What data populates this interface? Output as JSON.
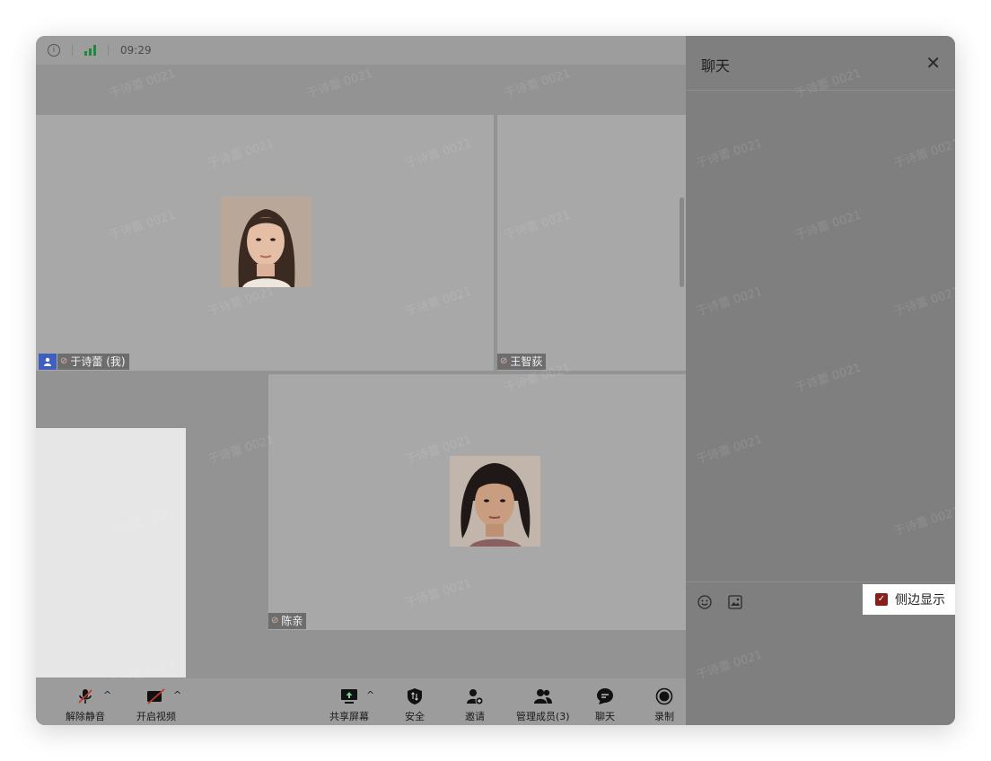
{
  "status": {
    "time": "09:29"
  },
  "participants": [
    {
      "name": "于诗蕾 (我)",
      "is_me": true
    },
    {
      "name": "王智荻"
    },
    {
      "name": "陈亲"
    }
  ],
  "chat": {
    "title": "聊天",
    "side_display_label": "侧边显示",
    "side_display_checked": true
  },
  "toolbar": {
    "unmute": "解除静音",
    "start_video": "开启视频",
    "share_screen": "共享屏幕",
    "security": "安全",
    "invite": "邀请",
    "manage_members": "管理成员(3)",
    "chat": "聊天",
    "record": "录制"
  },
  "watermark_text": "于诗蕾 0021",
  "colors": {
    "accent_red": "#8c1d1d",
    "signal_green": "#1f8a3c",
    "me_badge": "#3f5fbf"
  }
}
